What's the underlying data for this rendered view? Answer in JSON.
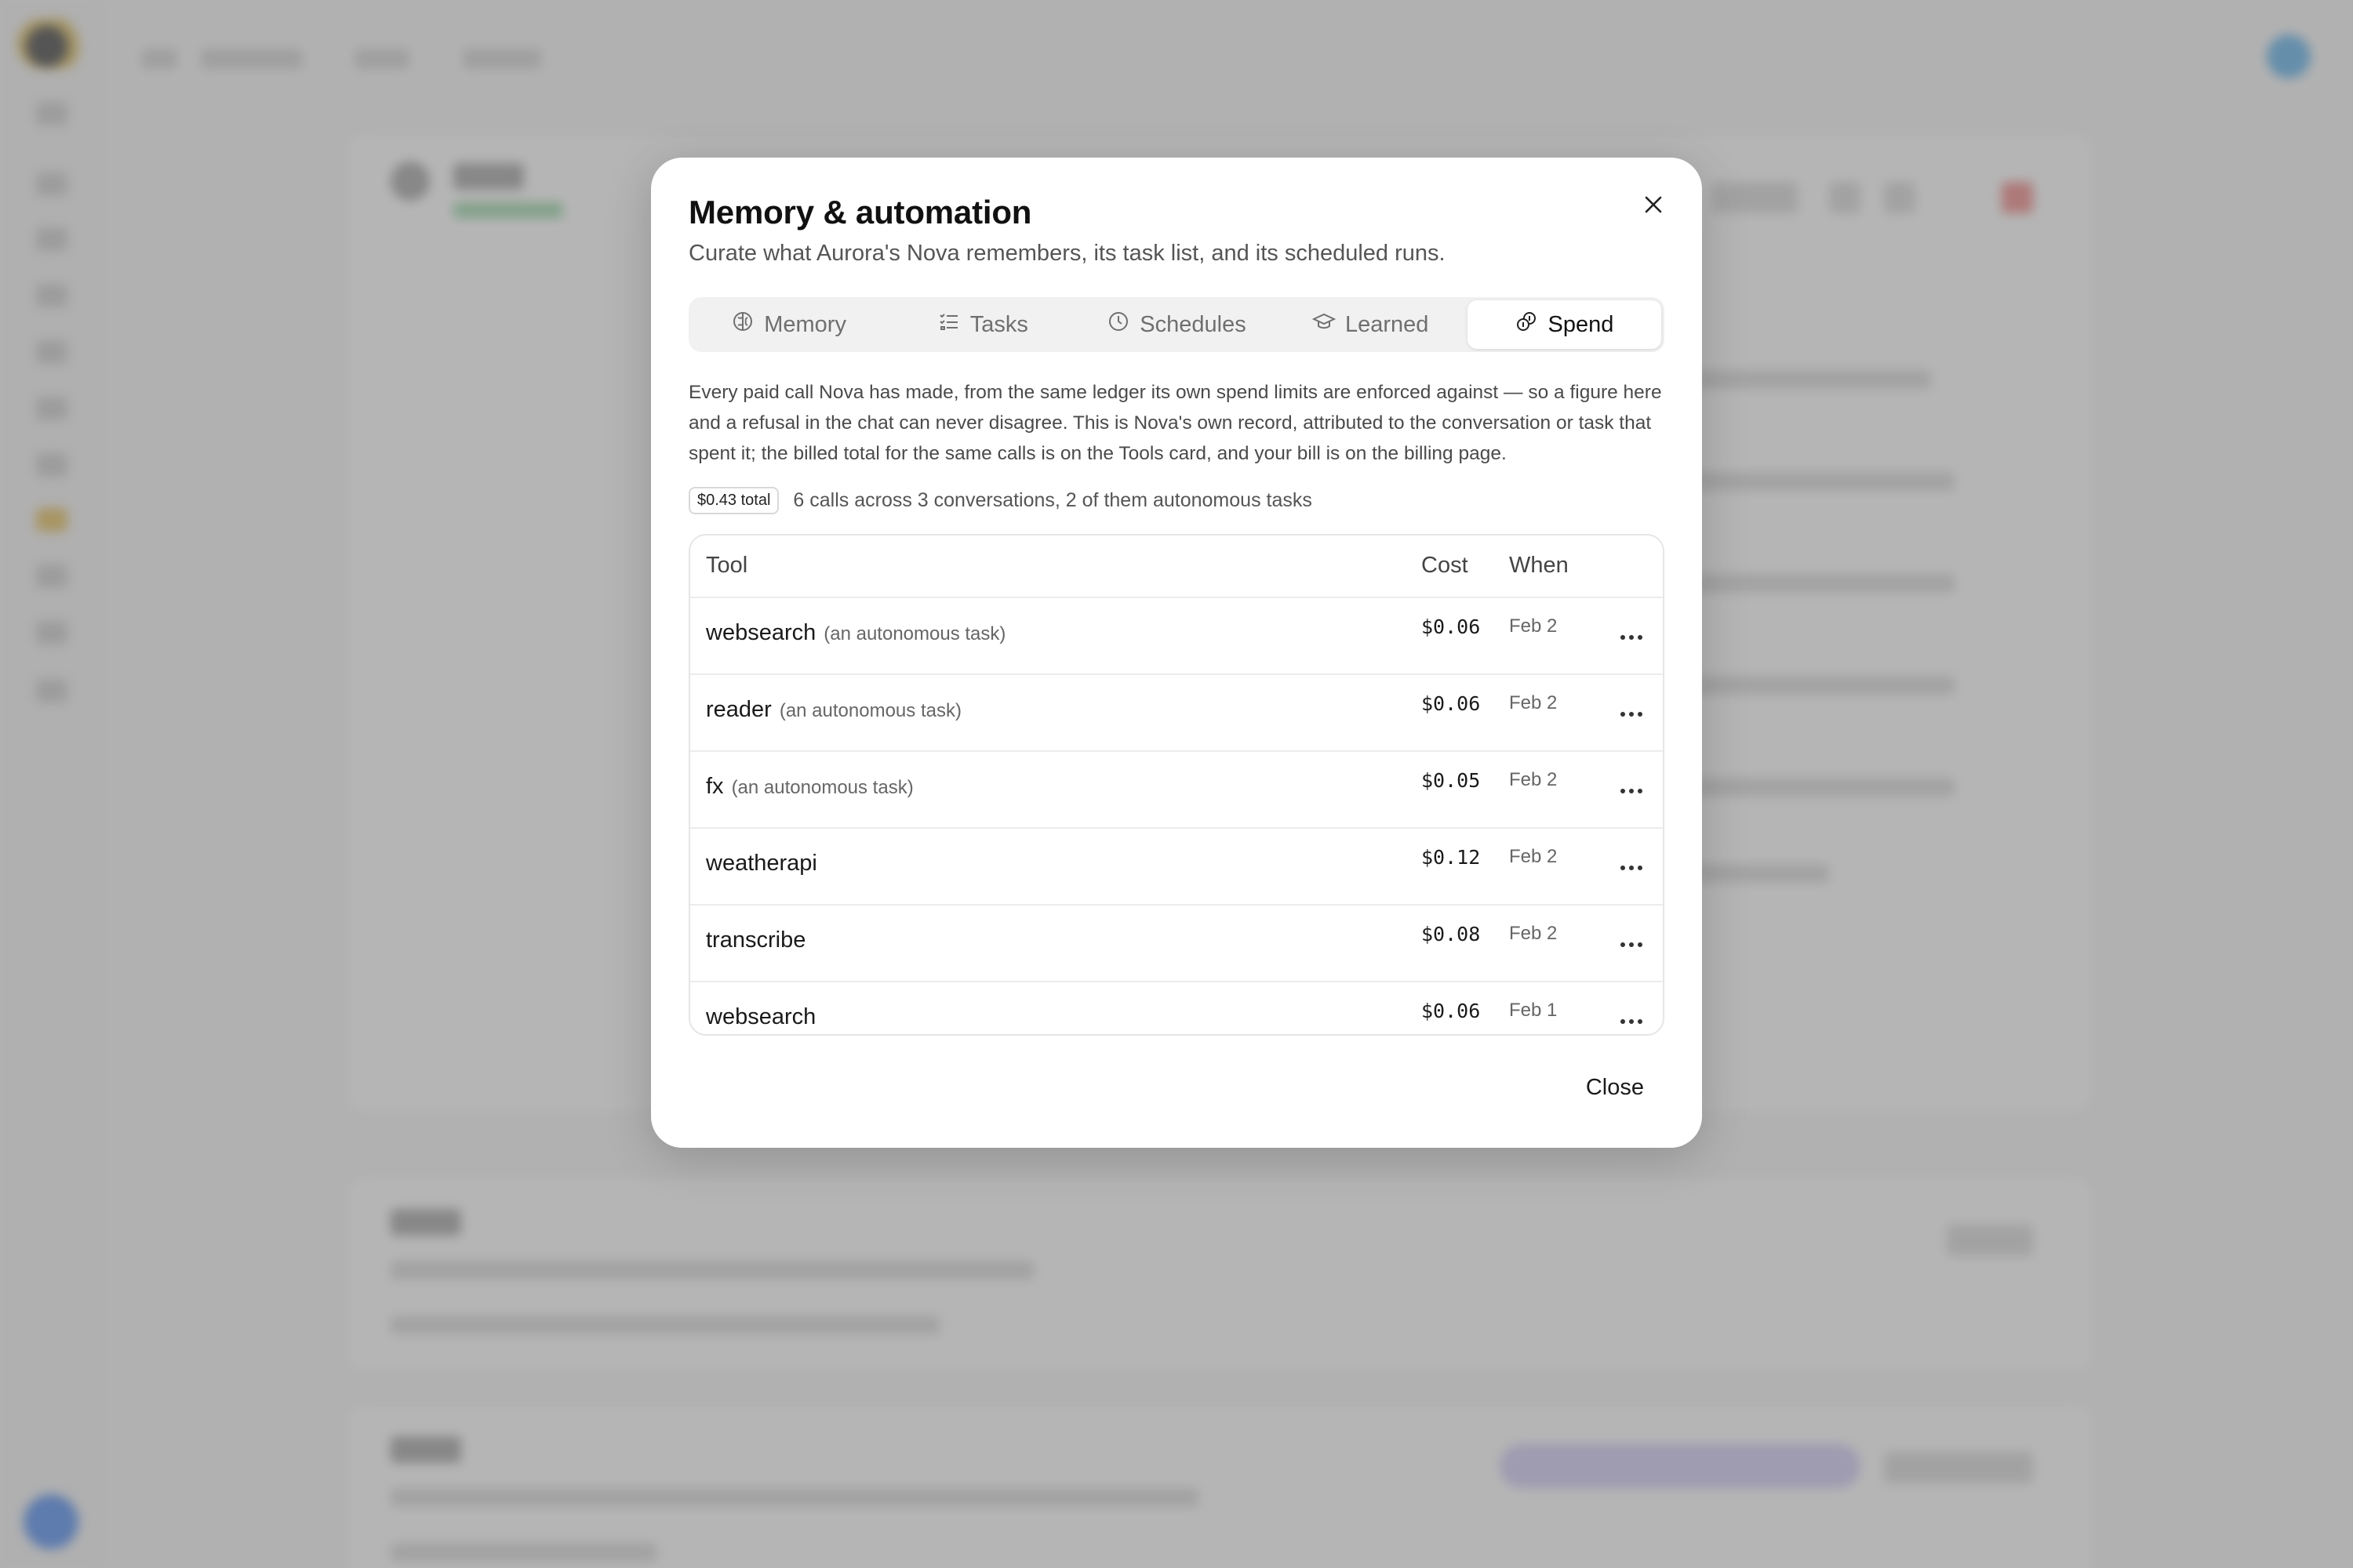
{
  "window": {
    "title": "Memory & automation",
    "subtitle": "Curate what Aurora's Nova remembers, its task list, and its scheduled runs.",
    "close_icon": "close-icon"
  },
  "tabs": [
    {
      "label": "Memory",
      "icon": "brain-icon"
    },
    {
      "label": "Tasks",
      "icon": "checklist-icon"
    },
    {
      "label": "Schedules",
      "icon": "clock-icon"
    },
    {
      "label": "Learned",
      "icon": "graduation-cap-icon"
    },
    {
      "label": "Spend",
      "icon": "coins-icon",
      "active": true
    }
  ],
  "spend": {
    "description": "Every paid call Nova has made, from the same ledger its own spend limits are enforced against — so a figure here and a refusal in the chat can never disagree. This is Nova's own record, attributed to the conversation or task that spent it; the billed total for the same calls is on the Tools card, and your bill is on the billing page.",
    "total_badge": "$0.43 total",
    "summary": "6 calls across 3 conversations, 2 of them autonomous tasks",
    "columns": {
      "tool": "Tool",
      "cost": "Cost",
      "when": "When"
    },
    "rows": [
      {
        "tool": "websearch",
        "note": "(an autonomous task)",
        "cost": "$0.06",
        "when": "Feb 2"
      },
      {
        "tool": "reader",
        "note": "(an autonomous task)",
        "cost": "$0.06",
        "when": "Feb 2"
      },
      {
        "tool": "fx",
        "note": "(an autonomous task)",
        "cost": "$0.05",
        "when": "Feb 2"
      },
      {
        "tool": "weatherapi",
        "note": "",
        "cost": "$0.12",
        "when": "Feb 2"
      },
      {
        "tool": "transcribe",
        "note": "",
        "cost": "$0.08",
        "when": "Feb 2"
      },
      {
        "tool": "websearch",
        "note": "",
        "cost": "$0.06",
        "when": "Feb 1"
      }
    ]
  },
  "footer": {
    "close_label": "Close"
  },
  "colors": {
    "overlay": "#787878",
    "accent_green": "#8fd39e",
    "danger": "#f07b7b"
  }
}
